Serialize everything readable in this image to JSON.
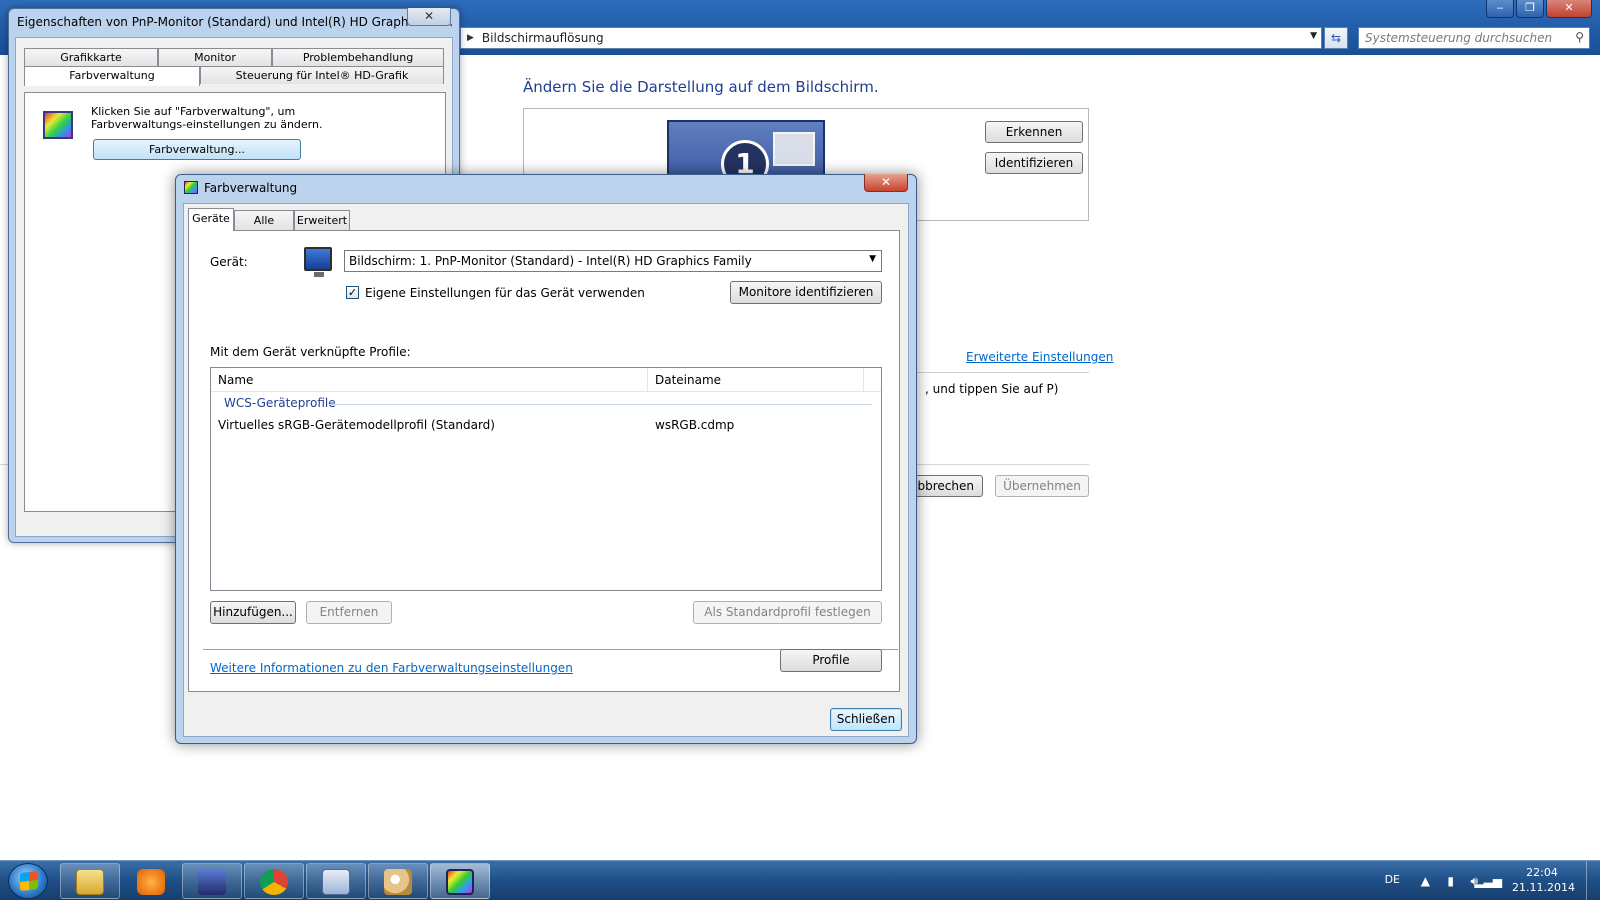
{
  "control_panel": {
    "breadcrumb": "Bildschirmauflösung",
    "search_placeholder": "Systemsteuerung durchsuchen",
    "heading": "Ändern Sie die Darstellung auf dem Bildschirm.",
    "monitor_number": "1",
    "detect_button": "Erkennen",
    "identify_button": "Identifizieren",
    "advanced_link": "Erweiterte Einstellungen",
    "partial_text": ", und tippen Sie auf P)",
    "cancel_button_partial": "bbrechen",
    "apply_button": "Übernehmen"
  },
  "properties_dialog": {
    "title": "Eigenschaften von PnP-Monitor (Standard) und Intel(R) HD Graphics Fa...",
    "close_glyph": "✕",
    "tabs": [
      "Grafikkarte",
      "Monitor",
      "Problembehandlung",
      "Farbverwaltung",
      "Steuerung für Intel® HD-Grafik"
    ],
    "description": "Klicken Sie auf \"Farbverwaltung\", um Farbverwaltungs-einstellungen zu ändern.",
    "color_mgmt_button": "Farbverwaltung..."
  },
  "color_management": {
    "title": "Farbverwaltung",
    "close_glyph": "✕",
    "tabs": [
      "Geräte",
      "Alle Profile",
      "Erweitert"
    ],
    "device_label": "Gerät:",
    "device_selected": "Bildschirm: 1. PnP-Monitor (Standard) - Intel(R) HD Graphics Family",
    "use_own_settings_label": "Eigene Einstellungen für das Gerät verwenden",
    "use_own_settings_checked": true,
    "identify_monitors_button": "Monitore identifizieren",
    "profiles_label": "Mit dem Gerät verknüpfte Profile:",
    "list_headers": [
      "Name",
      "Dateiname"
    ],
    "group_label": "WCS-Geräteprofile",
    "profiles": [
      {
        "name": "Virtuelles sRGB-Gerätemodellprofil (Standard)",
        "file": "wsRGB.cdmp"
      }
    ],
    "add_button": "Hinzufügen...",
    "remove_button": "Entfernen",
    "set_default_button": "Als Standardprofil festlegen",
    "more_info_link": "Weitere Informationen zu den Farbverwaltungseinstellungen",
    "profile_button": "Profile",
    "close_button": "Schließen"
  },
  "taskbar": {
    "language": "DE",
    "time": "22:04",
    "date": "21.11.2014",
    "apps": [
      "file-explorer",
      "media-player",
      "visual-studio",
      "chrome",
      "control-panel",
      "paint",
      "color-management"
    ]
  }
}
